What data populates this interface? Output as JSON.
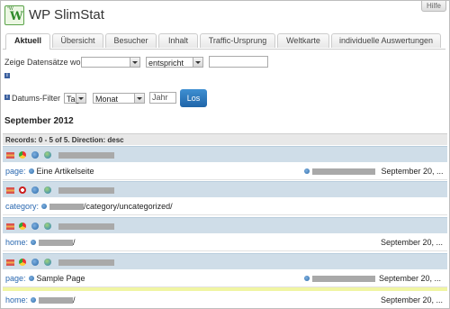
{
  "app": {
    "title": "WP SlimStat",
    "help_label": "Hilfe"
  },
  "tabs": [
    {
      "label": "Aktuell",
      "active": true
    },
    {
      "label": "Übersicht",
      "active": false
    },
    {
      "label": "Besucher",
      "active": false
    },
    {
      "label": "Inhalt",
      "active": false
    },
    {
      "label": "Traffic-Ursprung",
      "active": false
    },
    {
      "label": "Weltkarte",
      "active": false
    },
    {
      "label": "individuelle Auswertungen",
      "active": false
    }
  ],
  "filters": {
    "show_label": "Zeige Datensätze wo",
    "field_select": "",
    "operator_select": "entspricht",
    "value_input": "",
    "date_label": "Datums-Filter",
    "day_select": "Tag",
    "month_select": "Monat",
    "year_placeholder": "Jahr",
    "go_label": "Los"
  },
  "period_title": "September 2012",
  "records_header": "Records: 0 - 5 of 5. Direction: desc",
  "records": [
    {
      "browser": "chrome-icon",
      "highlighted": false,
      "resource_prefix": "page:",
      "resource_text": "Eine Artikelseite",
      "date": "September 20, ..."
    },
    {
      "browser": "opera-icon",
      "highlighted": false,
      "resource_prefix": "category:",
      "resource_text": "/category/uncategorized/",
      "date": "September 20, ..."
    },
    {
      "browser": "chrome-icon",
      "highlighted": false,
      "resource_prefix": "home:",
      "resource_text": "/",
      "date": "September 20, ..."
    },
    {
      "browser": "chrome-icon",
      "highlighted": false,
      "resource_prefix": "page:",
      "resource_text": "Sample Page",
      "date": "September 20, ..."
    },
    {
      "browser": "firefox-icon",
      "highlighted": true,
      "resource_prefix": "home:",
      "resource_text": "/",
      "date": "September 20, ..."
    }
  ]
}
